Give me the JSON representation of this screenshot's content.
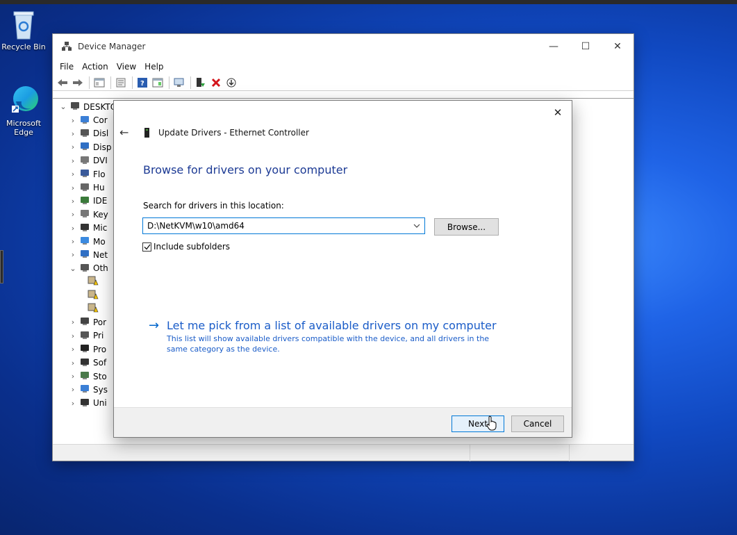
{
  "desktop": {
    "icons": [
      {
        "label": "Recycle Bin",
        "icon": "recycle-bin-icon"
      },
      {
        "label": "Microsoft Edge",
        "icon": "edge-icon"
      }
    ]
  },
  "device_manager": {
    "title": "Device Manager",
    "window_buttons": {
      "minimize": "—",
      "maximize": "☐",
      "close": "✕"
    },
    "menu": [
      "File",
      "Action",
      "View",
      "Help"
    ],
    "tree": {
      "root": "DESKTO",
      "items": [
        {
          "label": "Cor",
          "icon": "computer-icon"
        },
        {
          "label": "Disl",
          "icon": "disk-drive-icon"
        },
        {
          "label": "Disp",
          "icon": "display-adapter-icon"
        },
        {
          "label": "DVI",
          "icon": "dvd-drive-icon"
        },
        {
          "label": "Flo",
          "icon": "floppy-icon"
        },
        {
          "label": "Hu",
          "icon": "hid-icon"
        },
        {
          "label": "IDE",
          "icon": "ide-controller-icon"
        },
        {
          "label": "Key",
          "icon": "keyboard-icon"
        },
        {
          "label": "Mic",
          "icon": "mouse-icon"
        },
        {
          "label": "Mo",
          "icon": "monitor-icon"
        },
        {
          "label": "Net",
          "icon": "network-adapter-icon"
        },
        {
          "label": "Oth",
          "icon": "other-devices-icon",
          "expanded": true
        },
        {
          "label": "",
          "icon": "unknown-device-warning-icon",
          "child": true
        },
        {
          "label": "",
          "icon": "unknown-device-warning-icon",
          "child": true
        },
        {
          "label": "",
          "icon": "unknown-device-warning-icon",
          "child": true
        },
        {
          "label": "Por",
          "icon": "port-icon"
        },
        {
          "label": "Pri",
          "icon": "print-queue-icon"
        },
        {
          "label": "Pro",
          "icon": "processor-icon"
        },
        {
          "label": "Sof",
          "icon": "software-device-icon"
        },
        {
          "label": "Sto",
          "icon": "storage-controller-icon"
        },
        {
          "label": "Sys",
          "icon": "system-device-icon"
        },
        {
          "label": "Uni",
          "icon": "usb-controller-icon"
        }
      ]
    }
  },
  "dialog": {
    "close": "✕",
    "back": "←",
    "header_title": "Update Drivers - Ethernet Controller",
    "heading": "Browse for drivers on your computer",
    "search_label": "Search for drivers in this location:",
    "path_value": "D:\\NetKVM\\w10\\amd64",
    "browse_label": "Browse...",
    "include_subfolders_label": "Include subfolders",
    "include_subfolders_checked": true,
    "pick_link": {
      "arrow": "→",
      "title": "Let me pick from a list of available drivers on my computer",
      "description": "This list will show available drivers compatible with the device, and all drivers in the same category as the device."
    },
    "next_label": "Next",
    "cancel_label": "Cancel"
  }
}
